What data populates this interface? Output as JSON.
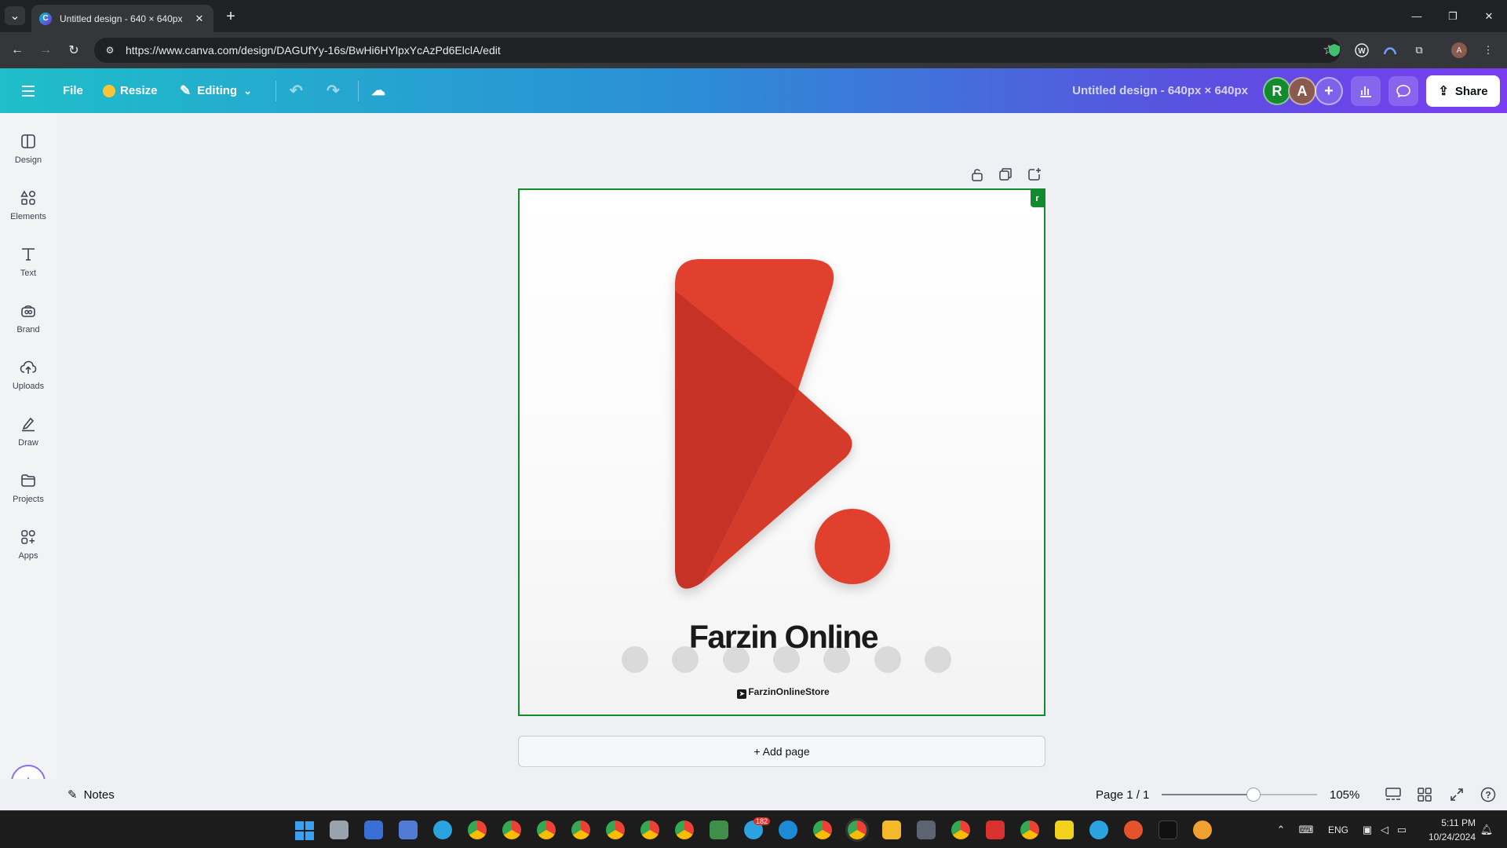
{
  "browser": {
    "tab_title": "Untitled design - 640 × 640px",
    "url": "https://www.canva.com/design/DAGUfYy-16s/BwHi6HYlpxYcAzPd6ElclA/edit",
    "tab_close": "✕",
    "new_tab": "+",
    "ext_badge": "5",
    "profile_initial": "A"
  },
  "toolbar": {
    "file": "File",
    "resize": "Resize",
    "editing": "Editing",
    "doc_title": "Untitled design - 640px × 640px",
    "share": "Share",
    "avatars": [
      "R",
      "A"
    ],
    "avatar_colors": [
      "#138a2e",
      "#8a5a4e"
    ]
  },
  "sidebar": {
    "items": [
      {
        "label": "Design",
        "icon": "layout-icon"
      },
      {
        "label": "Elements",
        "icon": "shapes-icon"
      },
      {
        "label": "Text",
        "icon": "text-icon"
      },
      {
        "label": "Brand",
        "icon": "brand-icon"
      },
      {
        "label": "Uploads",
        "icon": "cloud-upload-icon"
      },
      {
        "label": "Draw",
        "icon": "pen-icon"
      },
      {
        "label": "Projects",
        "icon": "folder-icon"
      },
      {
        "label": "Apps",
        "icon": "apps-icon"
      }
    ]
  },
  "canvas": {
    "brand_name": "Farzin Online",
    "handle": "FarzinOnlineStore",
    "collab_tag": "r",
    "add_page": "+ Add page",
    "logo_colors": {
      "primary": "#e2402f",
      "shadow": "#c73326",
      "dot": "#e2402f"
    }
  },
  "status": {
    "notes": "Notes",
    "page": "Page 1 / 1",
    "zoom": "105%",
    "zoom_fraction": 0.59
  },
  "taskbar": {
    "lang": "ENG",
    "time": "5:11 PM",
    "date": "10/24/2024",
    "badge_count": "182"
  }
}
